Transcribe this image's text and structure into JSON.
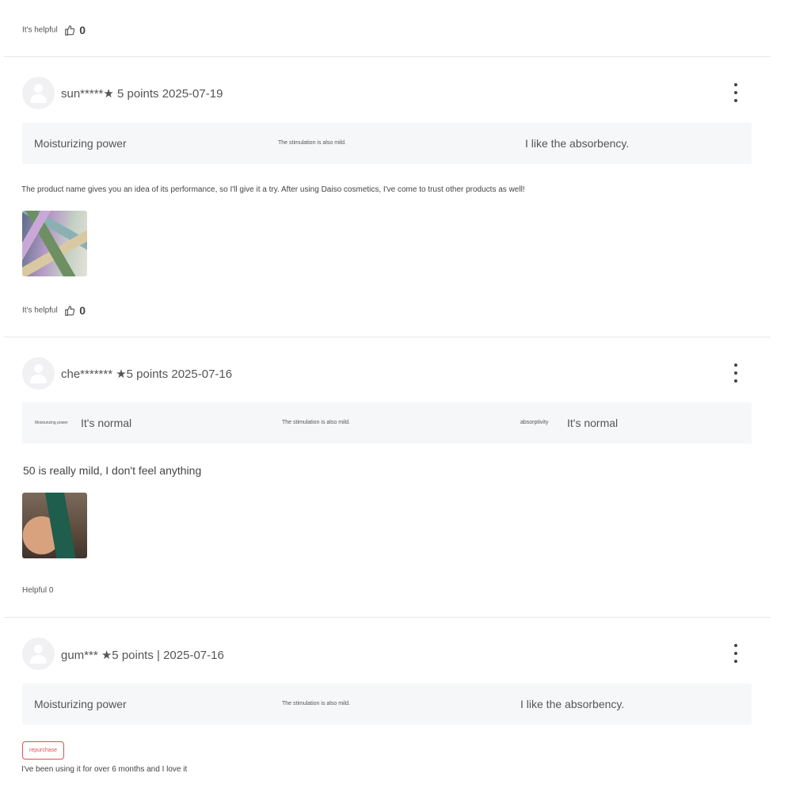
{
  "top_helpful": {
    "label": "It's helpful",
    "count": "0"
  },
  "reviews": [
    {
      "header": "sun*****★ 5 points 2025-07-19",
      "evals": [
        "Moisturizing power",
        "The stimulation is also mild.",
        "I like the absorbency."
      ],
      "text": "The product name gives you an idea of its performance, so I'll give it a try. After using Daiso cosmetics, I've come to trust other products as well!",
      "helpful_label": "It's helpful",
      "helpful_count": "0"
    },
    {
      "header": "che******* ★5 points 2025-07-16",
      "evals": [
        {
          "label": "Moisturizing power",
          "value": "It's normal"
        },
        {
          "label": "The stimulation is also mild."
        },
        {
          "label": "absorptivity",
          "value": "It's normal"
        }
      ],
      "text": "50 is really mild, I don't feel anything",
      "helpful": "Helpful 0"
    },
    {
      "header": "gum*** ★5 points | 2025-07-16",
      "evals": [
        "Moisturizing power",
        "The stimulation is also mild.",
        "I like the absorbency."
      ],
      "badge": "repurchase",
      "text": "I've been using it for over 6 months and I love it"
    }
  ],
  "colors": {
    "badge": "#e05050",
    "eval_bg": "#f6f7f9",
    "divider": "#e9e9e9"
  },
  "icons": [
    "thumbs-up-icon",
    "more-vertical-icon",
    "user-avatar-icon"
  ]
}
